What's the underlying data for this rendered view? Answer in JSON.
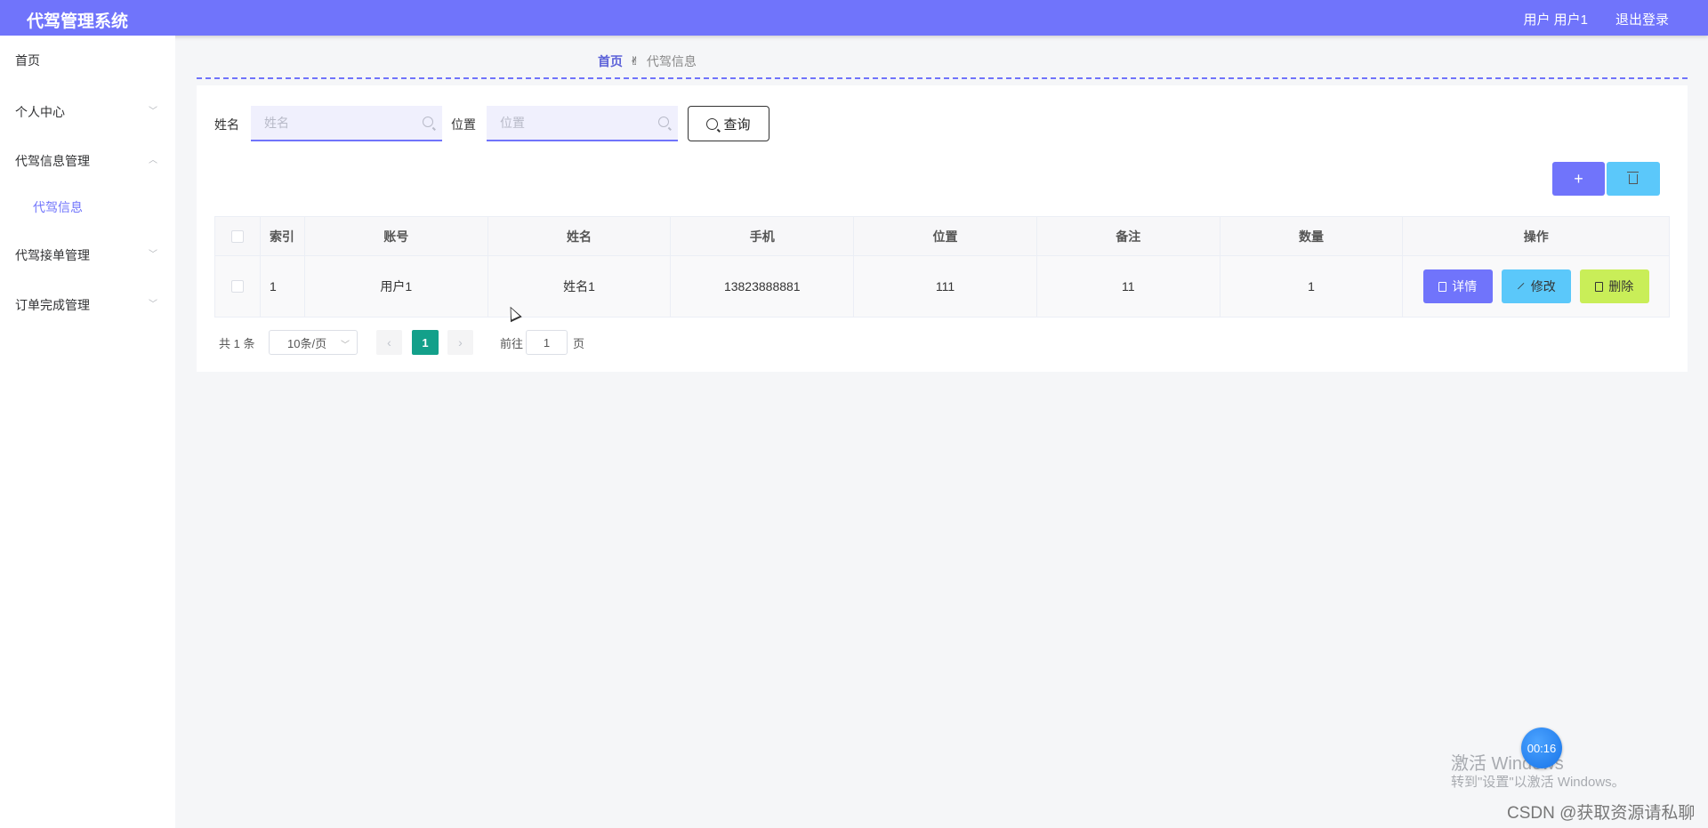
{
  "header": {
    "app_title": "代驾管理系统",
    "user_info": "用户 用户1",
    "logout_label": "退出登录"
  },
  "sidebar": {
    "items": [
      {
        "label": "首页"
      },
      {
        "label": "个人中心"
      },
      {
        "label": "代驾信息管理",
        "children": [
          {
            "label": "代驾信息"
          }
        ]
      },
      {
        "label": "代驾接单管理"
      },
      {
        "label": "订单完成管理"
      }
    ]
  },
  "breadcrumb": {
    "home": "首页",
    "separator_icon": "hand-icon",
    "current": "代驾信息"
  },
  "search": {
    "name_label": "姓名",
    "name_placeholder": "姓名",
    "name_value": "",
    "position_label": "位置",
    "position_placeholder": "位置",
    "position_value": "",
    "query_label": "查询"
  },
  "toolbar": {
    "add_label": "+",
    "add_icon": "plus-icon",
    "delete_icon": "trash-icon"
  },
  "table": {
    "columns": [
      "索引",
      "账号",
      "姓名",
      "手机",
      "位置",
      "备注",
      "数量",
      "操作"
    ],
    "rows": [
      {
        "index": "1",
        "account": "用户1",
        "name": "姓名1",
        "phone": "13823888881",
        "position": "111",
        "note": "11",
        "quantity": "1",
        "actions": [
          "详情",
          "修改",
          "删除"
        ]
      }
    ]
  },
  "pagination": {
    "total": "共 1 条",
    "page_size": "10条/页",
    "current_page": "1",
    "goto_label": "前往",
    "goto_value": "1",
    "page_suffix": "页"
  },
  "overlay": {
    "timer": "00:16",
    "activate_title": "激活 Windows",
    "activate_hint": "转到\"设置\"以激活 Windows。",
    "watermark": "CSDN @获取资源请私聊"
  },
  "colors": {
    "primary": "#7074fb",
    "info": "#5bc8fa",
    "danger_btn": "#c9ee58",
    "pagination_active": "#13a08a"
  }
}
